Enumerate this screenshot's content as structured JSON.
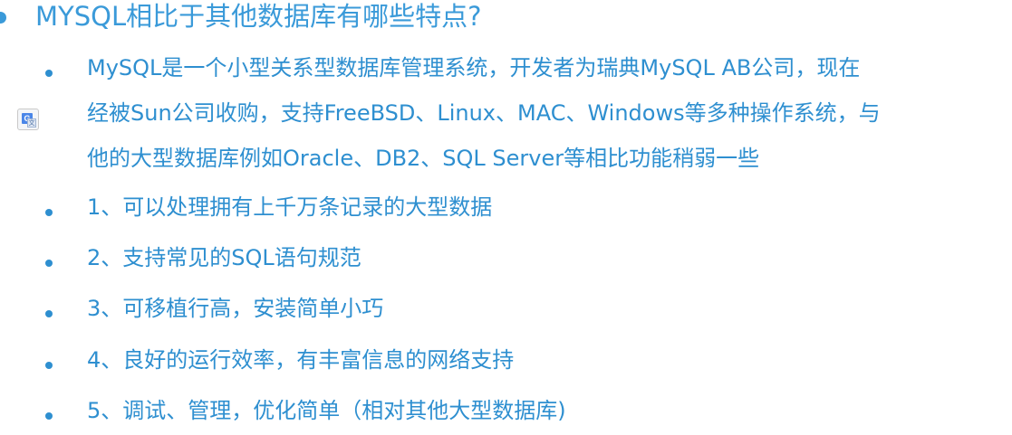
{
  "title": "MYSQL相比于其他数据库有哪些特点?",
  "items": [
    {
      "lines": [
        "MySQL是一个小型关系型数据库管理系统，开发者为瑞典MySQL AB公司，现在",
        "经被Sun公司收购，支持FreeBSD、Linux、MAC、Windows等多种操作系统，与",
        "他的大型数据库例如Oracle、DB2、SQL Server等相比功能稍弱一些"
      ]
    },
    {
      "lines": [
        "1、可以处理拥有上千万条记录的大型数据"
      ]
    },
    {
      "lines": [
        "2、支持常见的SQL语句规范"
      ]
    },
    {
      "lines": [
        "3、可移植行高，安装简单小巧"
      ]
    },
    {
      "lines": [
        "4、良好的运行效率，有丰富信息的网络支持"
      ]
    },
    {
      "lines": [
        "5、调试、管理，优化简单（相对其他大型数据库)"
      ]
    }
  ],
  "icons": {
    "translate": "google-translate-icon"
  },
  "colors": {
    "title": "#3a9ad9",
    "text": "#2e8fd0",
    "background": "#ffffff"
  }
}
